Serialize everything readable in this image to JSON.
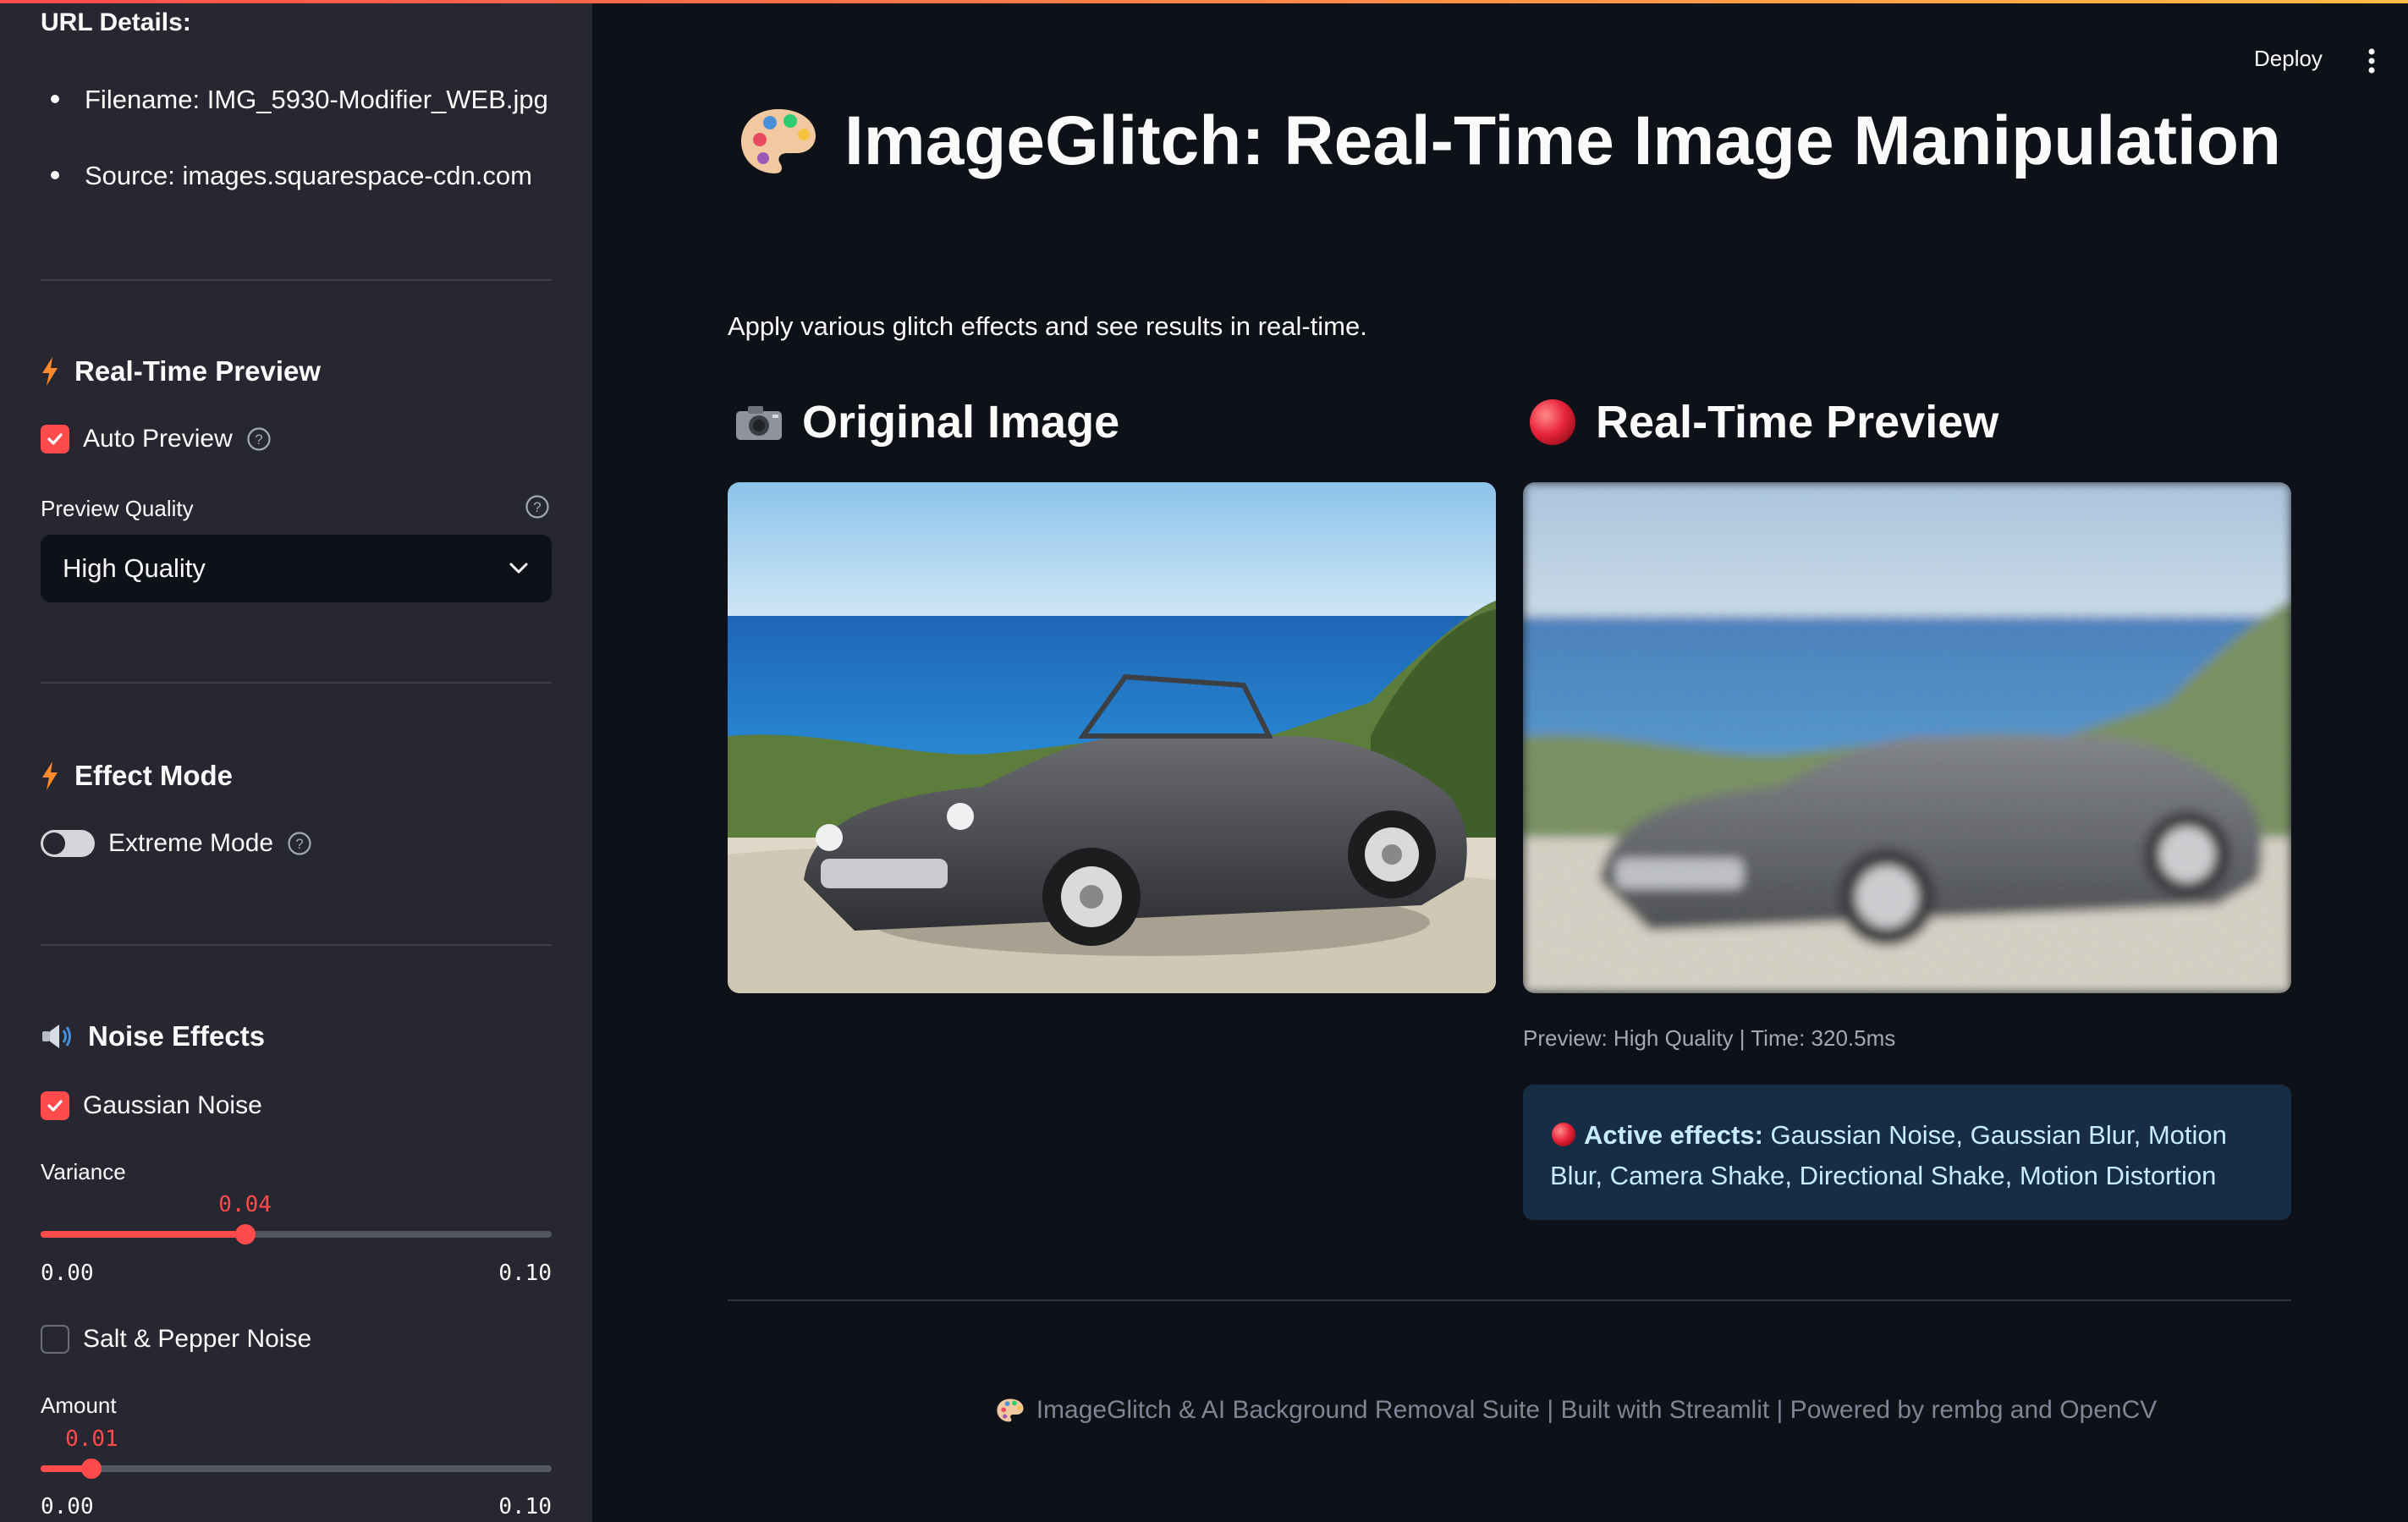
{
  "sidebar": {
    "url_details": {
      "title": "URL Details:",
      "filename": "Filename: IMG_5930-Modifier_WEB.jpg",
      "source": "Source: images.squarespace-cdn.com"
    },
    "realtime": {
      "heading": "Real-Time Preview",
      "auto_preview": {
        "label": "Auto Preview",
        "checked": true
      },
      "quality_label": "Preview Quality",
      "quality_value": "High Quality"
    },
    "effect_mode": {
      "heading": "Effect Mode",
      "extreme": {
        "label": "Extreme Mode",
        "on": false
      }
    },
    "noise": {
      "heading": "Noise Effects",
      "gaussian": {
        "label": "Gaussian Noise",
        "checked": true
      },
      "variance": {
        "label": "Variance",
        "value": "0.04",
        "min": "0.00",
        "max": "0.10",
        "fraction": 0.4
      },
      "salt_pepper": {
        "label": "Salt & Pepper Noise",
        "checked": false
      },
      "amount": {
        "label": "Amount",
        "value": "0.01",
        "min": "0.00",
        "max": "0.10",
        "fraction": 0.1
      }
    }
  },
  "header": {
    "deploy_label": "Deploy"
  },
  "main": {
    "title": "ImageGlitch: Real-Time Image Manipulation",
    "subtitle": "Apply various glitch effects and see results in real-time.",
    "original_heading": "Original Image",
    "preview_heading": "Real-Time Preview",
    "preview_caption": "Preview: High Quality | Time: 320.5ms",
    "active_label": "Active effects:",
    "active_effects": "Gaussian Noise, Gaussian Blur, Motion Blur, Camera Shake, Directional Shake, Motion Distortion"
  },
  "footer": {
    "text": "ImageGlitch & AI Background Removal Suite | Built with Streamlit | Powered by rembg and OpenCV"
  },
  "colors": {
    "accent": "#ff4b4b",
    "background": "#0e1117",
    "sidebar": "#262730",
    "info_bg": "#172d43"
  },
  "icons": [
    "palette-icon",
    "camera-icon",
    "red-circle-icon",
    "bolt-icon",
    "speaker-icon",
    "help-icon",
    "chevron-down-icon",
    "menu-dots-icon"
  ]
}
